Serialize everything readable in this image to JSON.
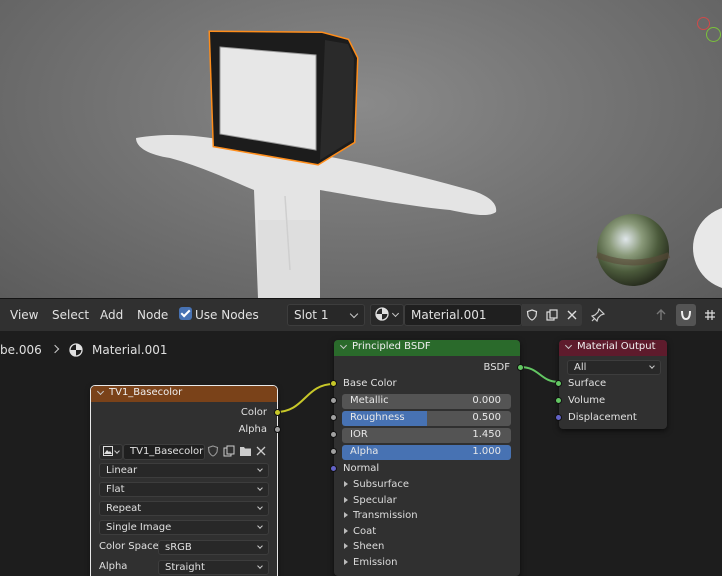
{
  "header": {
    "menus": [
      "View",
      "Select",
      "Add",
      "Node"
    ],
    "use_nodes_label": "Use Nodes",
    "slot": "Slot 1",
    "material_name": "Material.001"
  },
  "breadcrumb": {
    "object": "be.006",
    "material": "Material.001"
  },
  "nodes": {
    "image_texture": {
      "title": "TV1_Basecolor",
      "outputs": [
        "Color",
        "Alpha"
      ],
      "image_name": "TV1_Basecolor",
      "interpolation": "Linear",
      "projection": "Flat",
      "extension": "Repeat",
      "source": "Single Image",
      "color_space_label": "Color Space",
      "color_space": "sRGB",
      "alpha_label": "Alpha",
      "alpha_mode": "Straight"
    },
    "principled": {
      "title": "Principled BSDF",
      "output": "BSDF",
      "base_color": "Base Color",
      "metallic_label": "Metallic",
      "metallic": "0.000",
      "metallic_frac": 0.0,
      "roughness_label": "Roughness",
      "roughness": "0.500",
      "roughness_frac": 0.5,
      "ior_label": "IOR",
      "ior": "1.450",
      "ior_frac": 0.0,
      "alpha_label": "Alpha",
      "alpha": "1.000",
      "alpha_frac": 1.0,
      "normal": "Normal",
      "panels": [
        "Subsurface",
        "Specular",
        "Transmission",
        "Coat",
        "Sheen",
        "Emission"
      ]
    },
    "output": {
      "title": "Material Output",
      "target": "All",
      "inputs": [
        "Surface",
        "Volume",
        "Displacement"
      ]
    }
  },
  "colors": {
    "texture_header": "#7a4219",
    "shader_header": "#2a6a2b",
    "output_header": "#5e1b2c",
    "color_socket": "#c7c729",
    "shader_socket": "#63c763",
    "vector_socket": "#6363c7",
    "float_socket": "#a1a1a1",
    "accent": "#4772b3",
    "selection": "#ff8d1a"
  }
}
